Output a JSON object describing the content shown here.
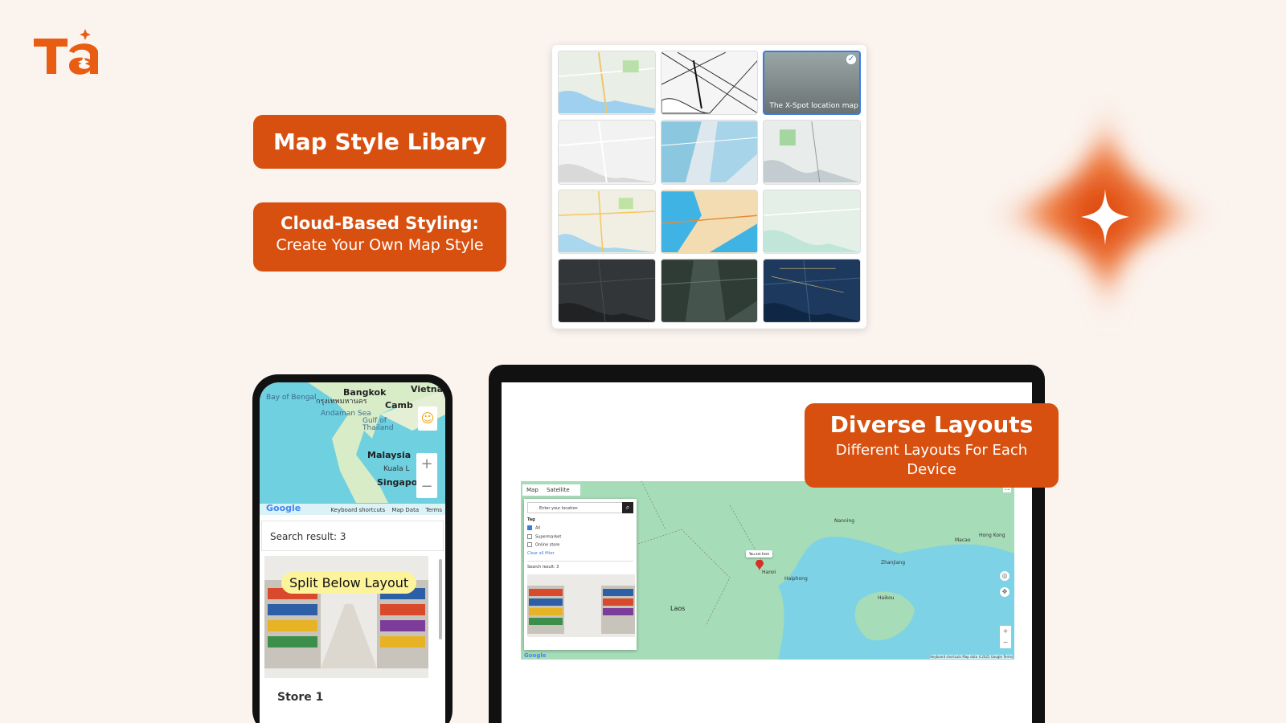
{
  "brand": {
    "logo_text": "Ta",
    "accent": "#d8500f"
  },
  "badges": {
    "map_style_library": "Map Style Libary",
    "cloud_line1": "Cloud-Based Styling:",
    "cloud_line2": "Create Your Own Map Style",
    "diverse_title": "Diverse Layouts",
    "diverse_sub": "Different Layouts For Each Device",
    "split_below": "Split Below Layout"
  },
  "style_grid": {
    "selected_label": "The X-Spot location map",
    "tiles": [
      "standard",
      "black-white",
      "x-spot",
      "silver",
      "blue-water",
      "grey-green",
      "light",
      "bright-blue",
      "mint",
      "dark",
      "dark-green",
      "night-blue"
    ]
  },
  "phone": {
    "map_labels": {
      "bangkok": "Bangkok",
      "bangkok_thai": "กรุงเทพมหานคร",
      "vietnam": "Vietna",
      "bay": "Bay of Bengal",
      "cambodia": "Camb",
      "andaman": "Andaman Sea",
      "gulf": "Gulf of Thailand",
      "malaysia": "Malaysia",
      "kuala": "Kuala L",
      "singapore": "Singapo"
    },
    "footer": {
      "google": "Google",
      "keyboard": "Keyboard shortcuts",
      "map_data": "Map Data",
      "terms": "Terms"
    },
    "search_result": "Search result: 3",
    "store_name": "Store 1"
  },
  "laptop": {
    "tabs": [
      "Map",
      "Satellite"
    ],
    "search_placeholder": "Enter your location",
    "tag_label": "Tag",
    "options": [
      "All",
      "Supermarket",
      "Online store"
    ],
    "clear_filter": "Clear all filter",
    "search_result": "Search result: 3",
    "pin_tooltip": "You are here",
    "labels": {
      "laos": "Laos",
      "hanoi": "Hanoi",
      "haiphong": "Haiphong",
      "nanning": "Nanning",
      "macao": "Macao",
      "hongkong": "Hong Kong",
      "zhanjiang": "Zhanjiang",
      "haikou": "Haikou"
    },
    "footer": {
      "google": "Google",
      "keyboard": "Keyboard shortcuts",
      "map_data": "Map data ©2025 Google",
      "terms": "Terms"
    }
  }
}
